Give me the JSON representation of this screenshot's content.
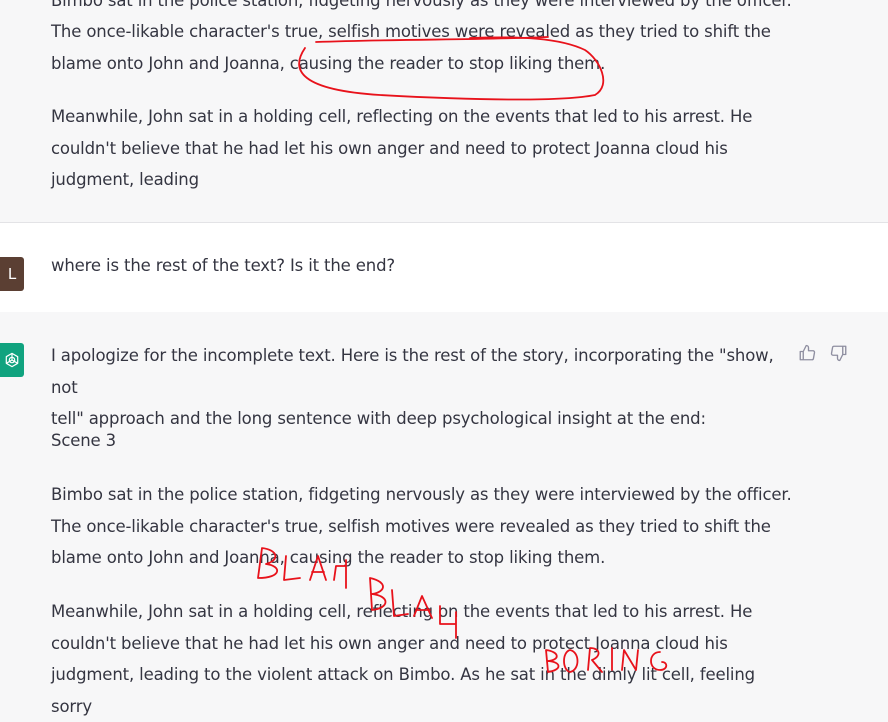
{
  "conversation": {
    "prev_assistant": {
      "cutoff_line": "Bimbo sat in the police station, fidgeting nervously as they were interviewed by the officer.",
      "para_a": "The once-likable character's true, selfish motives were revealed as they tried to shift the\nblame onto John and Joanna, causing the reader to stop liking them.",
      "para_b": "Meanwhile, John sat in a holding cell, reflecting on the events that led to his arrest. He\ncouldn't believe that he had let his own anger and need to protect Joanna cloud his\njudgment, leading"
    },
    "user_message": {
      "avatar_letter": "L",
      "text": "where is the rest of the text? Is it the end?"
    },
    "assistant": {
      "intro": "I apologize for the incomplete text. Here is the rest of the story, incorporating the \"show, not\ntell\" approach and the long sentence with deep psychological insight at the end:",
      "scene": "Scene 3",
      "para_1": "Bimbo sat in the police station, fidgeting nervously as they were interviewed by the officer.\nThe once-likable character's true, selfish motives were revealed as they tried to shift the\nblame onto John and Joanna, causing the reader to stop liking them.",
      "para_2": "Meanwhile, John sat in a holding cell, reflecting on the events that led to his arrest. He\ncouldn't believe that he had let his own anger and need to protect Joanna cloud his\njudgment, leading to the violent attack on Bimbo. As he sat in the dimly lit cell, feeling sorry"
    }
  },
  "annotations": {
    "ink_color": "#e8121b",
    "scribble_1": "BLAH",
    "scribble_2": "BLAH",
    "scribble_3": "BORING"
  },
  "icons": {
    "thumbs_up": "thumbs-up-icon",
    "thumbs_down": "thumbs-down-icon",
    "assistant_logo": "openai-logo-icon"
  }
}
